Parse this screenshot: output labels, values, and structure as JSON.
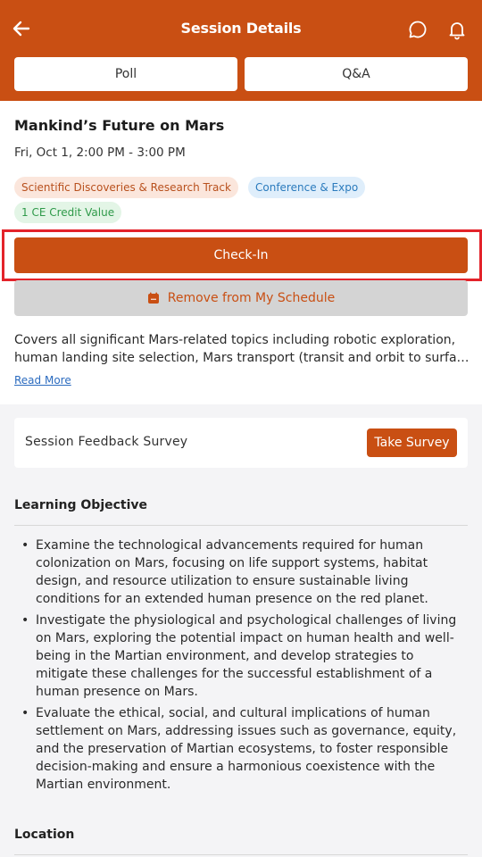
{
  "header": {
    "title": "Session Details",
    "tabs": [
      {
        "label": "Poll"
      },
      {
        "label": "Q&A"
      }
    ],
    "brand_color": "#c94f13"
  },
  "session": {
    "title": "Mankind’s Future on Mars",
    "time": "Fri, Oct 1, 2:00 PM - 3:00 PM",
    "tags": [
      {
        "label": "Scientific Discoveries & Research Track"
      },
      {
        "label": "Conference & Expo"
      },
      {
        "label": "1 CE Credit Value"
      }
    ],
    "check_in_label": "Check-In",
    "remove_label": "Remove from My Schedule",
    "description_line1": "Covers all significant Mars-related topics including robotic exploration,",
    "description_line2": "human landing site selection, Mars transport (transit and orbit to surface)",
    "read_more": "Read More"
  },
  "survey": {
    "label": "Session Feedback Survey",
    "button": "Take Survey"
  },
  "learning_objective": {
    "heading": "Learning Objective",
    "items": [
      "Examine the technological advancements required for human colonization on Mars, focusing on life support systems, habitat design, and resource utilization to ensure sustainable living conditions for an extended human presence on the red planet.",
      "Investigate the physiological and psychological challenges of living on Mars, exploring the potential impact on human health and well-being in the Martian environment, and develop strategies to mitigate these challenges for the successful establishment of a human presence on Mars.",
      "Evaluate the ethical, social, and cultural implications of human settlement on Mars, addressing issues such as governance, equity, and the preservation of Martian ecosystems, to foster responsible decision-making and ensure a harmonious coexistence with the Martian environment."
    ]
  },
  "location": {
    "heading": "Location"
  }
}
